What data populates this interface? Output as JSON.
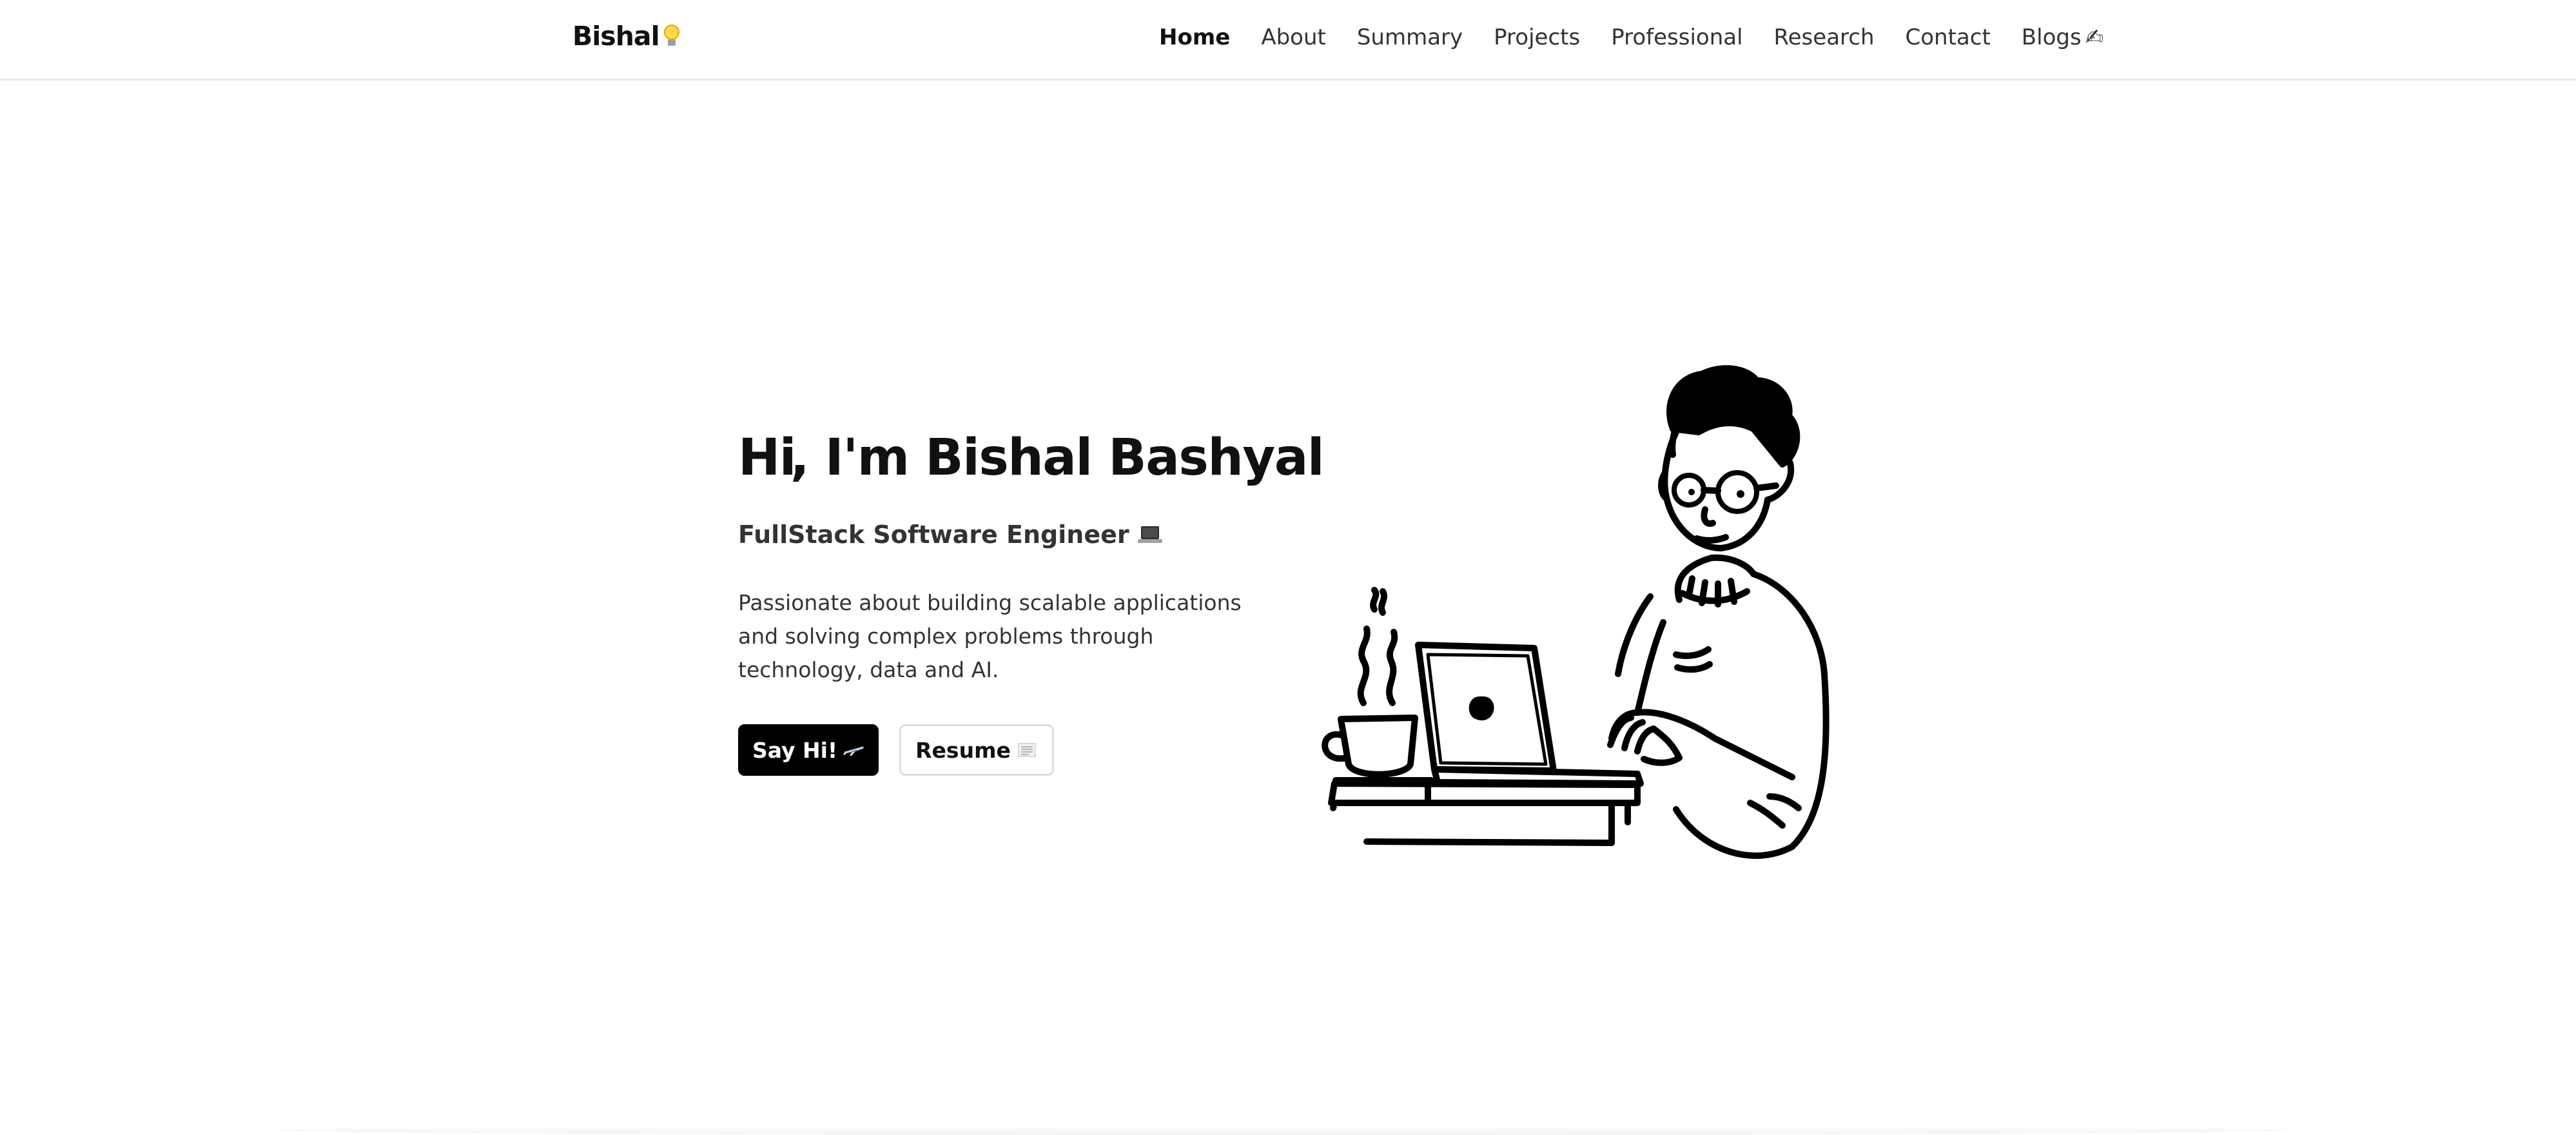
{
  "brand": {
    "name": "Bishal",
    "icon": "lightbulb-icon"
  },
  "nav": {
    "items": [
      {
        "label": "Home",
        "active": true
      },
      {
        "label": "About"
      },
      {
        "label": "Summary"
      },
      {
        "label": "Projects"
      },
      {
        "label": "Professional"
      },
      {
        "label": "Research"
      },
      {
        "label": "Contact"
      },
      {
        "label": "Blogs",
        "icon": "writing-hand-icon",
        "glyph": "✍"
      }
    ]
  },
  "hero": {
    "greeting": "Hi",
    "wave_icon": "waving-hand-icon",
    "name_text": ", I'm Bishal Bashyal",
    "subtitle": "FullStack Software Engineer",
    "subtitle_icon": "laptop-icon",
    "description": "Passionate about building scalable applications and solving complex problems through technology, data and AI.",
    "primary_button": "Say Hi!",
    "primary_button_icon": "airplane-icon",
    "secondary_button": "Resume",
    "secondary_button_icon": "document-icon"
  },
  "colors": {
    "background": "#ffffff",
    "text": "#111111",
    "primary_button": "#000000",
    "border": "#dcdcdc"
  }
}
